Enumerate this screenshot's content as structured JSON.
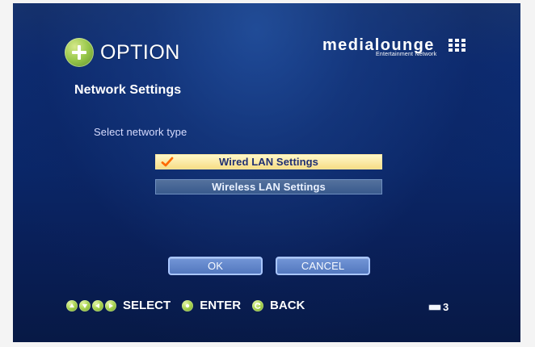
{
  "header": {
    "title": "OPTION",
    "brand_main": "medialounge",
    "brand_sub": "Entertainment Network"
  },
  "page": {
    "section_title": "Network Settings",
    "prompt": "Select network type",
    "options": [
      "Wired LAN Settings",
      "Wireless LAN Settings"
    ],
    "selected_option": "Wired LAN Settings"
  },
  "buttons": {
    "ok": "OK",
    "cancel": "CANCEL"
  },
  "footer": {
    "select_label": "SELECT",
    "enter_label": "ENTER",
    "back_label": "BACK",
    "page_number": "3"
  },
  "colors": {
    "background_dark": "#091f58",
    "background_mid": "#0d2c72",
    "selected_option": "#f7dd86",
    "unselected_option": "#395a8d",
    "button": "#5378be",
    "accent_green": "#99c84b",
    "checkmark": "#ff6a00"
  },
  "icons": [
    "option-plus-icon",
    "brand-grid-icon",
    "checkmark-icon",
    "up-arrow-icon",
    "down-arrow-icon",
    "left-arrow-icon",
    "right-arrow-icon",
    "enter-icon",
    "back-icon",
    "page-indicator-icon"
  ]
}
